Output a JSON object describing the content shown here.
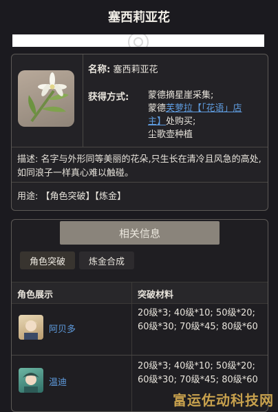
{
  "page": {
    "title": "塞西莉亚花"
  },
  "item_card": {
    "name_key": "名称:",
    "name_value": "塞西莉亚花",
    "obtain_key": "获得方式:",
    "obtain": {
      "line1": "蒙德摘星崖采集;",
      "line2_prefix": "蒙德",
      "line2_link": "芙萝拉【「花语」店",
      "line3_link": "主】",
      "line3_suffix": "处购买;",
      "line4": "尘歌壶种植"
    },
    "description": "描述: 名字与外形同等美丽的花朵,只生长在清冷且风急的高处,如同浪子一样真心难以触碰。",
    "usage": "用途: 【角色突破】【炼金】"
  },
  "related": {
    "header": "相关信息",
    "tabs": [
      "角色突破",
      "炼金合成"
    ],
    "columns": [
      "角色展示",
      "突破材料"
    ],
    "rows": [
      {
        "name": "阿贝多",
        "materials": "20级*3; 40级*10; 50级*20; 60级*30; 70级*45; 80级*60"
      },
      {
        "name": "温迪",
        "materials": "20级*3; 40级*10; 50级*20; 60级*30; 70级*45; 80级*60"
      }
    ]
  },
  "watermark": "富运佐动科技网",
  "colors": {
    "background": "#1b1a1f",
    "link": "#5f9de0",
    "header_band": "#8a847b",
    "watermark": "#e6b955"
  }
}
